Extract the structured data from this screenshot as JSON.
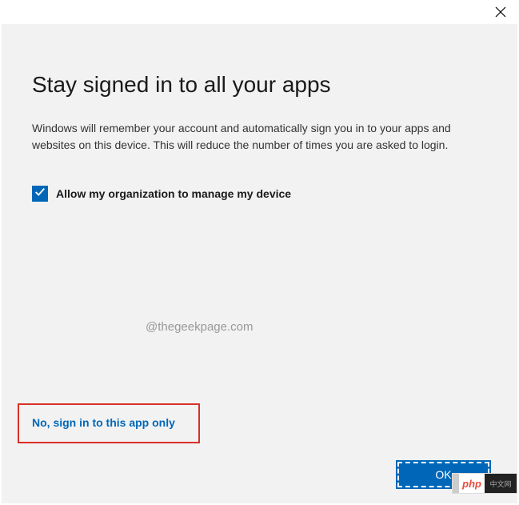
{
  "dialog": {
    "title": "Stay signed in to all your apps",
    "description": "Windows will remember your account and automatically sign you in to your apps and websites on this device. This will reduce the number of times you are asked to login.",
    "checkbox_label": "Allow my organization to manage my device",
    "checkbox_checked": true,
    "link_text": "No, sign in to this app only",
    "ok_button": "OK"
  },
  "watermark": "@thegeekpage.com",
  "badge": {
    "text": "php",
    "suffix": "中文网"
  }
}
